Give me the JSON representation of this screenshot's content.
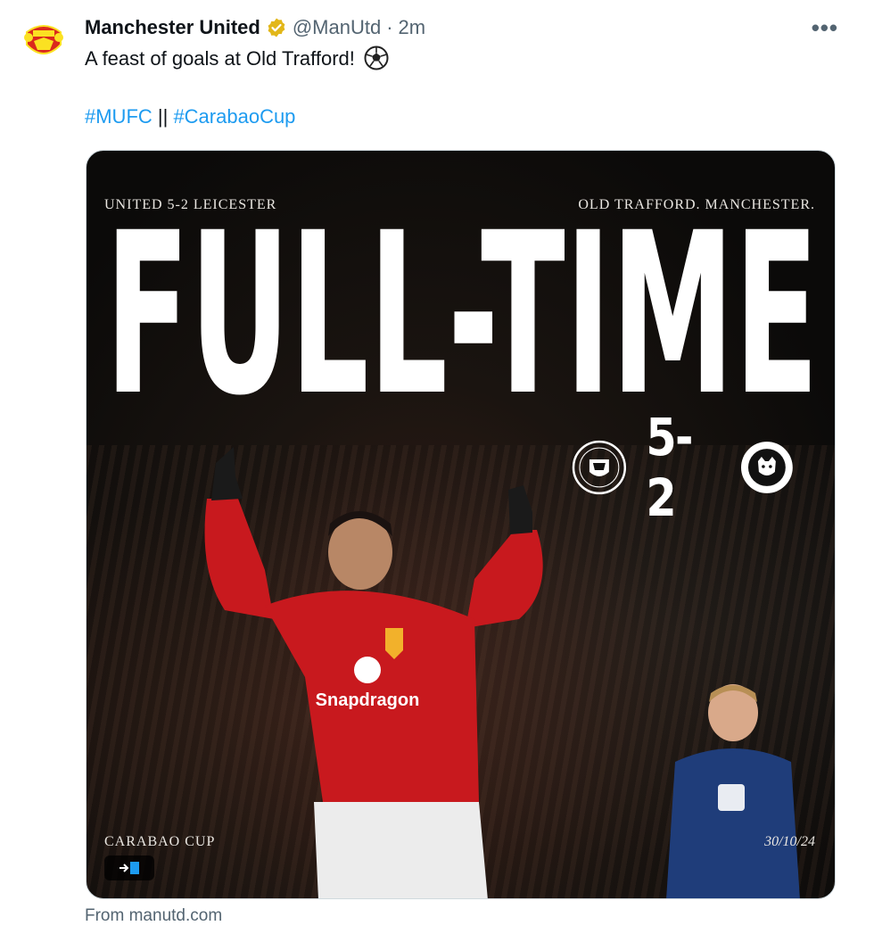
{
  "tweet": {
    "author_name": "Manchester United",
    "handle": "@ManUtd",
    "separator": "·",
    "time": "2m",
    "more_label": "•••",
    "text": "A feast of goals at Old Trafford!",
    "hashtag1": "#MUFC",
    "hashtag_sep": " || ",
    "hashtag2": "#CarabaoCup",
    "source": "From manutd.com"
  },
  "graphic": {
    "top_left": "UNITED 5-2 LEICESTER",
    "top_right": "OLD TRAFFORD. MANCHESTER.",
    "headline": "FULL-TIME",
    "score": "5-2",
    "competition": "CARABAO CUP",
    "date": "30/10/24",
    "sponsor": "Snapdragon",
    "home_crest_text": "MANCHESTER UNITED",
    "away_crest_text": "LEICESTER CITY FOOTBALL CLUB"
  },
  "colors": {
    "verified_gold": "#e2b719",
    "link_blue": "#1d9bf0",
    "shirt_red": "#c8191e",
    "away_blue": "#1f3d7a"
  }
}
